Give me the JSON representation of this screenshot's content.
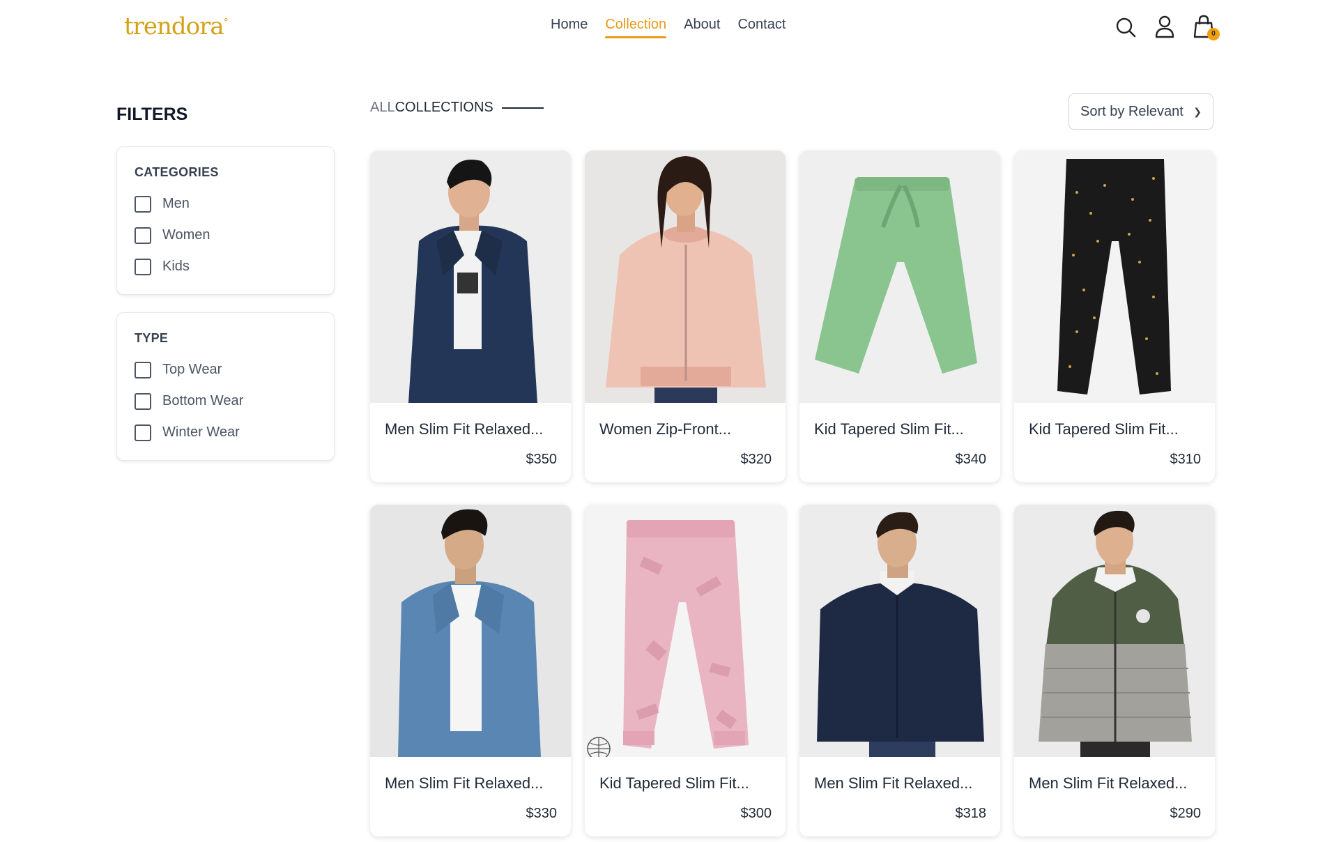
{
  "header": {
    "logo_text": "trendora",
    "logo_mark": "°",
    "nav": [
      "Home",
      "Collection",
      "About",
      "Contact"
    ],
    "active_nav": "Collection",
    "cart_count": "0",
    "icons": [
      "search-icon",
      "user-icon",
      "shopping-bag-icon"
    ]
  },
  "filters": {
    "title": "FILTERS",
    "categories": {
      "heading": "CATEGORIES",
      "options": [
        "Men",
        "Women",
        "Kids"
      ]
    },
    "type": {
      "heading": "TYPE",
      "options": [
        "Top Wear",
        "Bottom Wear",
        "Winter Wear"
      ]
    }
  },
  "collection": {
    "title_prefix": "ALL",
    "title_main": "COLLECTIONS",
    "sort_label": "Sort by Relevant"
  },
  "products": [
    {
      "name": "Men Slim Fit Relaxed...",
      "price": "$350"
    },
    {
      "name": "Women Zip-Front...",
      "price": "$320"
    },
    {
      "name": "Kid Tapered Slim Fit...",
      "price": "$340"
    },
    {
      "name": "Kid Tapered Slim Fit...",
      "price": "$310"
    },
    {
      "name": "Men Slim Fit Relaxed...",
      "price": "$330"
    },
    {
      "name": "Kid Tapered Slim Fit...",
      "price": "$300"
    },
    {
      "name": "Men Slim Fit Relaxed...",
      "price": "$318"
    },
    {
      "name": "Men Slim Fit Relaxed...",
      "price": "$290"
    }
  ],
  "colors": {
    "accent": "#e89b14",
    "logo": "#d4a017",
    "text": "#1f2937"
  }
}
